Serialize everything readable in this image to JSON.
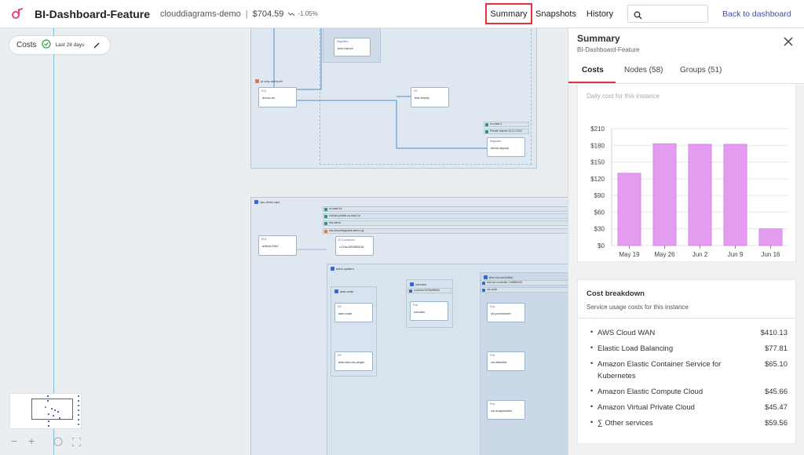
{
  "header": {
    "app_title": "BI-Dashboard-Feature",
    "project": "clouddiagrams-demo",
    "separator": "|",
    "cost": "$704.59",
    "trend": "-1.05%",
    "nav": {
      "summary": "Summary",
      "snapshots": "Snapshots",
      "history": "History"
    },
    "search": {
      "value": "",
      "placeholder": ""
    },
    "back_link": "Back to dashboard"
  },
  "canvas": {
    "cost_chip": {
      "label": "Costs",
      "range": "Last 28 days"
    },
    "groups": {
      "top_region": "eu-west-1",
      "top_sub": "Private subnet 10.0.2.0/24",
      "pipeline": "pl.cmp.demo-fd",
      "bottom_vpc": "vpc-demo-ops",
      "eks_region": "us-east-1a",
      "eks_subnet": "subnet-private-us-east-1a",
      "eks_cluster": "eks-demo",
      "eks_ng": "eks-clouddiagrams-demo-ng",
      "kube_system": "kube-system",
      "coredns": "coredns",
      "coredns_rs": "coredns-5d78c9869d",
      "aws_node": "aws-node",
      "ebs_controller": "ebs-csi-controller",
      "ebs_rs": "ebs-csi-controller-7c6f8f9c5b",
      "csi_node": "csi-node"
    },
    "nodes": {
      "migration": {
        "type": "Migration",
        "name": "test branch"
      },
      "demo_ab": {
        "type": "Ec2",
        "name": "demo-ab"
      },
      "test_empty": {
        "type": "S3",
        "name": "test-empty"
      },
      "demo_signup": {
        "type": "Migration",
        "name": "demo-signup"
      },
      "ec2_instance": {
        "type": "EC2 instance",
        "name": "i-07ac1f5f3f0f43d"
      },
      "elb_ab": {
        "type": "ELB",
        "name": "a0fca123b7"
      },
      "aws_node_pod": {
        "type": "DS",
        "name": "aws-node"
      },
      "coredns_pod": {
        "type": "Pod",
        "name": "coredns"
      },
      "csi_provisioner": {
        "type": "Pod",
        "name": "csi-provisioner"
      },
      "csi_attacher": {
        "type": "Pod",
        "name": "csi-attacher"
      },
      "csi_snapshotter": {
        "type": "Pod",
        "name": "csi-snapshotter"
      },
      "aws_ebs_plugin": {
        "type": "DS",
        "name": "aws-ebs-csi-plugin"
      }
    }
  },
  "panel": {
    "title": "Summary",
    "subtitle": "BI-Dashboard-Feature",
    "tabs": [
      "Costs",
      "Nodes (58)",
      "Groups (51)"
    ],
    "chart_caption": "Daily cost for this instance",
    "breakdown": {
      "title": "Cost breakdown",
      "subtitle": "Service usage costs for this instance",
      "items": [
        {
          "name": "AWS Cloud WAN",
          "value": "$410.13"
        },
        {
          "name": "Elastic Load Balancing",
          "value": "$77.81"
        },
        {
          "name": "Amazon Elastic Container Service for Kubernetes",
          "value": "$65.10"
        },
        {
          "name": "Amazon Elastic Compute Cloud",
          "value": "$45.66"
        },
        {
          "name": "Amazon Virtual Private Cloud",
          "value": "$45.47"
        },
        {
          "name": "∑ Other services",
          "value": "$59.56"
        }
      ]
    }
  },
  "colors": {
    "accent": "#e0333a",
    "bar": "#e39cf0",
    "link": "#3f4fa8",
    "edge": "#4a90d0"
  },
  "chart_data": {
    "type": "bar",
    "categories": [
      "May 19",
      "May 26",
      "Jun 2",
      "Jun 9",
      "Jun 16"
    ],
    "values": [
      130,
      183,
      182,
      182,
      30
    ],
    "ylim": [
      0,
      210
    ],
    "yticks": [
      "$0",
      "$30",
      "$60",
      "$90",
      "$120",
      "$150",
      "$180",
      "$210"
    ],
    "ytick_values": [
      0,
      30,
      60,
      90,
      120,
      150,
      180,
      210
    ],
    "grid": "horizontal",
    "legend": "none"
  }
}
